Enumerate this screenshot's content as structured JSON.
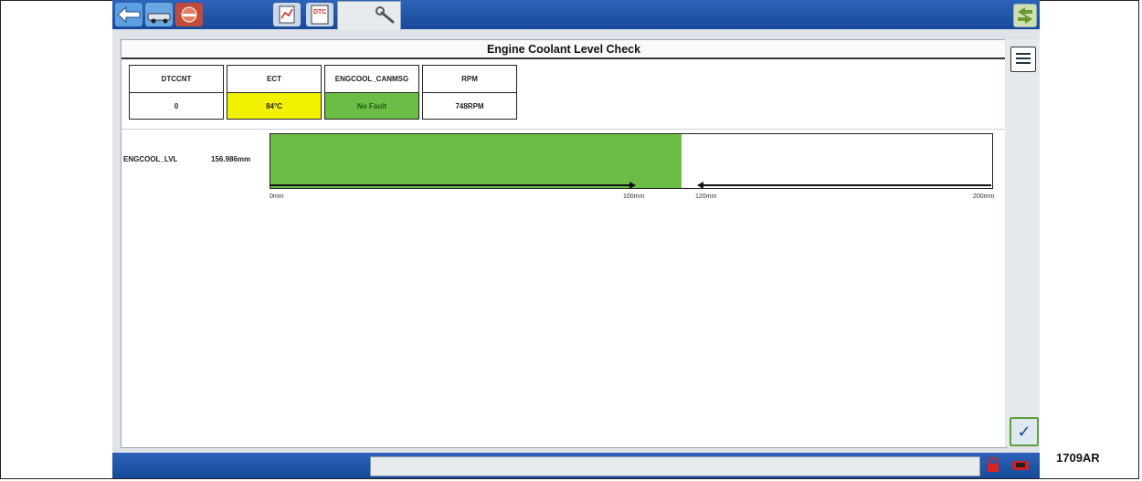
{
  "toolbar": {
    "icons": [
      "back-arrow-icon",
      "vehicle-icon",
      "tools-icon",
      "data-logger-icon",
      "dtc-icon",
      "wrench-icon"
    ],
    "dtc_text": "DTC"
  },
  "main": {
    "title": "Engine Coolant Level Check",
    "pids": [
      {
        "name": "DTCCNT",
        "value": "0",
        "color": "#ffffff"
      },
      {
        "name": "ECT",
        "value": "84°C",
        "color": "#f2f200"
      },
      {
        "name": "ENGCOOL_CANMSG",
        "value": "No Fault",
        "color": "#6cbd45"
      },
      {
        "name": "RPM",
        "value": "748RPM",
        "color": "#ffffff"
      }
    ],
    "gauge": {
      "name": "ENGCOOL_LVL",
      "value_text": "156.986mm",
      "value": 114,
      "min": 0,
      "max": 200,
      "fill_color": "#6cbd45",
      "ticks": [
        "0mm",
        "100mm",
        "120mm",
        "200mm"
      ],
      "tick_values": [
        0,
        100,
        120,
        200
      ]
    }
  },
  "figure_label": "1709AR"
}
